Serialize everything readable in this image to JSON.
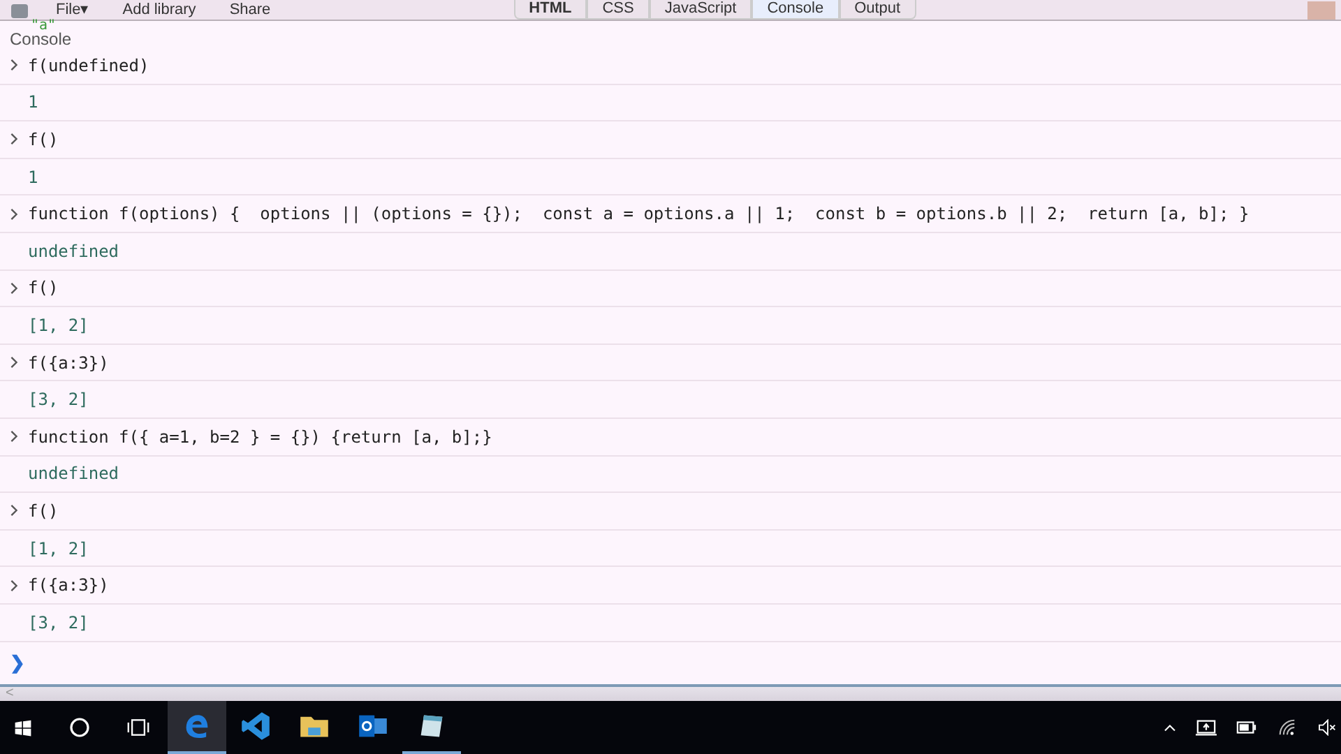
{
  "toolbar": {
    "menus": [
      {
        "label": "File",
        "caret": "▾"
      },
      {
        "label": "Add library"
      },
      {
        "label": "Share"
      }
    ],
    "tabs": [
      {
        "label": "HTML",
        "selected": false
      },
      {
        "label": "CSS",
        "selected": false
      },
      {
        "label": "JavaScript",
        "selected": false
      },
      {
        "label": "Console",
        "selected": true
      },
      {
        "label": "Output",
        "selected": false
      }
    ]
  },
  "previous_output": "\"a\"",
  "console": {
    "title": "Console",
    "lines": [
      {
        "kind": "input",
        "text": "f(undefined)"
      },
      {
        "kind": "result",
        "text": "1"
      },
      {
        "kind": "input",
        "text": "f()"
      },
      {
        "kind": "result",
        "text": "1"
      },
      {
        "kind": "input",
        "text": "function f(options) {  options || (options = {});  const a = options.a || 1;  const b = options.b || 2;  return [a, b]; }"
      },
      {
        "kind": "result",
        "text": "undefined"
      },
      {
        "kind": "input",
        "text": "f()"
      },
      {
        "kind": "result",
        "text": "[1, 2]"
      },
      {
        "kind": "input",
        "text": "f({a:3})"
      },
      {
        "kind": "result",
        "text": "[3, 2]"
      },
      {
        "kind": "input",
        "text": "function f({ a=1, b=2 } = {}) {return [a, b];}"
      },
      {
        "kind": "result",
        "text": "undefined"
      },
      {
        "kind": "input",
        "text": "f()"
      },
      {
        "kind": "result",
        "text": "[1, 2]"
      },
      {
        "kind": "input",
        "text": "f({a:3})"
      },
      {
        "kind": "result",
        "text": "[3, 2]"
      }
    ],
    "prompt": "❯"
  },
  "scrollbar_arrow": "<",
  "taskbar": {
    "apps": [
      {
        "kind": "edge",
        "active": true,
        "running": true
      },
      {
        "kind": "code",
        "active": false,
        "running": false
      },
      {
        "kind": "folder",
        "active": false,
        "running": false
      },
      {
        "kind": "mail",
        "active": false,
        "running": false
      },
      {
        "kind": "notepad",
        "active": false,
        "running": true
      }
    ]
  }
}
